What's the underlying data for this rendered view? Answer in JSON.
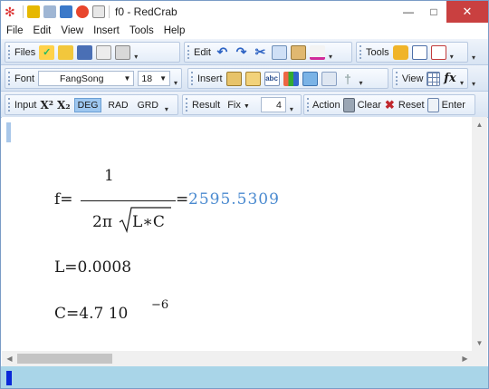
{
  "window": {
    "title": "f0 - RedCrab"
  },
  "menu": [
    "File",
    "Edit",
    "View",
    "Insert",
    "Tools",
    "Help"
  ],
  "toolbars": {
    "files_label": "Files",
    "edit_label": "Edit",
    "tools_label": "Tools",
    "font_label": "Font",
    "font_name": "FangSong",
    "font_size": "18",
    "insert_label": "Insert",
    "view_label": "View",
    "input_label": "Input",
    "sup_label": "X²",
    "sub_label": "X₂",
    "angle_modes": [
      "DEG",
      "RAD",
      "GRD"
    ],
    "active_mode": "DEG",
    "result_label": "Result",
    "result_format": "Fix",
    "precision": "4",
    "action_label": "Action",
    "clear_label": "Clear",
    "reset_label": "Reset",
    "enter_label": "Enter"
  },
  "document": {
    "f_lhs": "f=",
    "f_num": "1",
    "f_den_prefix": "2π",
    "f_den_rad": "L∗C",
    "f_eq": "=",
    "f_result": "2595.5309",
    "L_line": "L=0.0008",
    "C_base": "C=4.7  10",
    "C_exp": "−6"
  },
  "colors": {
    "result": "#4a8ad0",
    "status_bar": "#a9d5e8",
    "status_cursor": "#0a28d8"
  }
}
